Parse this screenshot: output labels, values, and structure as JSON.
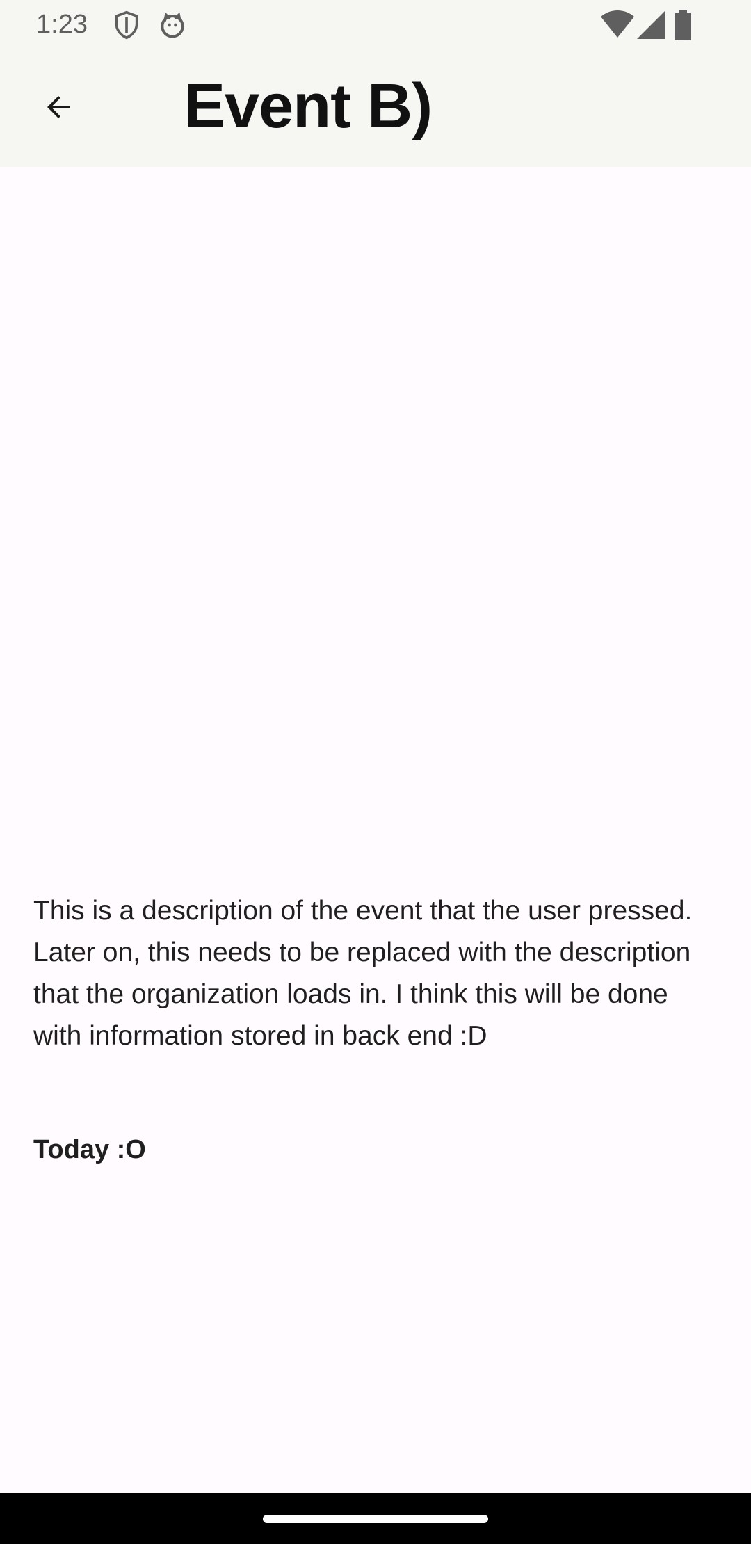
{
  "status_bar": {
    "time": "1:23",
    "icons": [
      "shield-icon",
      "cat-face-icon",
      "wifi-icon",
      "cellular-signal-icon",
      "battery-icon"
    ]
  },
  "app_bar": {
    "back_icon": "arrow-back-icon",
    "title": "Event B)"
  },
  "event": {
    "description": "This is a description of the event that the user pressed. Later on, this needs to be replaced with the description that the organization loads in. I think this will be done with information stored in back end :D",
    "date": "Today :O"
  },
  "colors": {
    "app_bar_bg": "#f6f6f3",
    "content_bg": "#fffbfe",
    "text": "#1f1f1f",
    "nav_bar_bg": "#000000"
  }
}
